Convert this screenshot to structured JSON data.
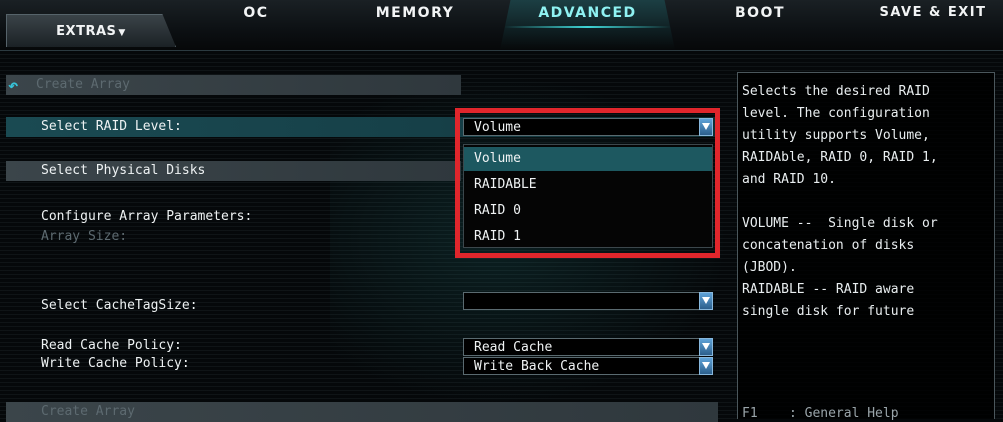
{
  "nav": {
    "extras": "EXTRAS",
    "tabs": [
      "OC",
      "MEMORY",
      "ADVANCED",
      "BOOT",
      "SAVE & EXIT"
    ],
    "active_tab": "ADVANCED"
  },
  "main": {
    "create_array_top": "Create Array",
    "select_raid_level": "Select RAID Level:",
    "raid_level_value": "Volume",
    "select_physical_disks": "Select Physical Disks",
    "configure_array_parameters": "Configure Array Parameters:",
    "array_size": "Array Size:",
    "select_cache_tag_size": "Select CacheTagSize:",
    "cache_tag_size_value": "",
    "read_cache_policy": "Read Cache Policy:",
    "read_cache_value": "Read Cache",
    "write_cache_policy": "Write Cache Policy:",
    "write_cache_value": "Write Back Cache",
    "create_array_bottom": "Create Array"
  },
  "dropdown": {
    "options": [
      "Volume",
      "RAIDABLE",
      "RAID 0",
      "RAID 1"
    ],
    "selected": "Volume"
  },
  "help": {
    "text": "Selects the desired RAID\nlevel. The configuration\nutility supports Volume,\nRAIDAble, RAID 0, RAID 1,\nand RAID 10.\n\nVOLUME --  Single disk or\nconcatenation of disks\n(JBOD).\nRAIDABLE -- RAID aware\nsingle disk for future",
    "footer": "F1    : General Help"
  },
  "colors": {
    "accent": "#3fd6d6",
    "highlight": "#e0262c",
    "selected_row": "#1d5860"
  }
}
